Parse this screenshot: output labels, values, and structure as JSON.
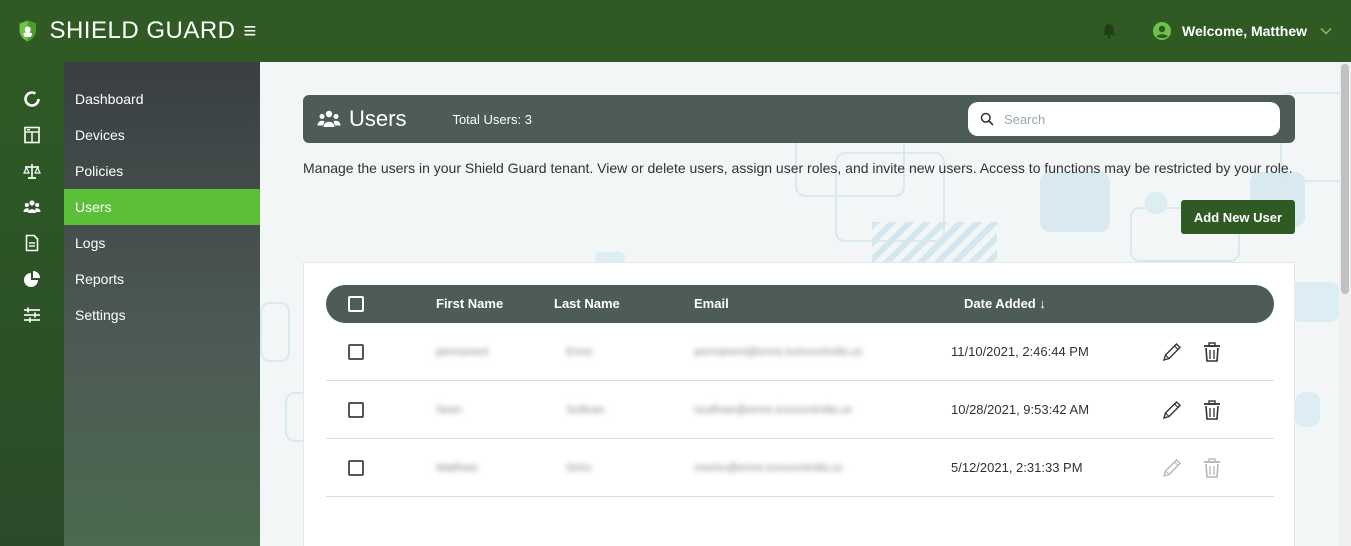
{
  "app": {
    "brand_name": "SHIELD GUARD",
    "hamburger_glyph": "≡",
    "welcome_text": "Welcome, Matthew",
    "colors": {
      "primary_green": "#2f5a24",
      "active_green": "#5bbf38",
      "header_slate": "#4d5b59"
    }
  },
  "sidebar": {
    "items": [
      {
        "label": "Dashboard",
        "icon": "dashboard-icon",
        "active": false
      },
      {
        "label": "Devices",
        "icon": "devices-icon",
        "active": false
      },
      {
        "label": "Policies",
        "icon": "scale-icon",
        "active": false
      },
      {
        "label": "Users",
        "icon": "users-icon",
        "active": true
      },
      {
        "label": "Logs",
        "icon": "document-icon",
        "active": false
      },
      {
        "label": "Reports",
        "icon": "pie-chart-icon",
        "active": false
      },
      {
        "label": "Settings",
        "icon": "sliders-icon",
        "active": false
      }
    ]
  },
  "users_page": {
    "title": "Users",
    "total_label": "Total Users: 3",
    "search_placeholder": "Search",
    "description": "Manage the users in your Shield Guard tenant. View or delete users, assign user roles, and invite new users. Access to functions may be restricted by your role.",
    "add_button_label": "Add New User"
  },
  "table": {
    "columns": {
      "first_name": "First Name",
      "last_name": "Last Name",
      "email": "Email",
      "date_added": "Date Added ↓"
    },
    "rows": [
      {
        "first": "permanent",
        "last": "Emre",
        "email": "permanent@emre.iconcontrolla.us",
        "date": "11/10/2021, 2:46:44 PM",
        "actions_enabled": true
      },
      {
        "first": "Sean",
        "last": "Sullivan",
        "email": "ssullivan@emre.iconcontrolla.us",
        "date": "10/28/2021, 9:53:42 AM",
        "actions_enabled": true
      },
      {
        "first": "Matthew",
        "last": "Sohu",
        "email": "msohu@emre.iconcontrolla.us",
        "date": "5/12/2021, 2:31:33 PM",
        "actions_enabled": false
      }
    ]
  }
}
